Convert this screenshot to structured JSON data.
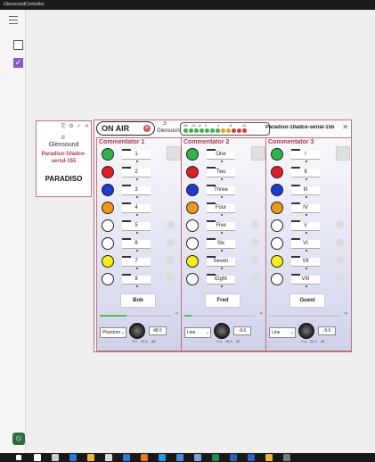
{
  "window": {
    "title": "GlensoundController"
  },
  "device_card": {
    "tools": [
      "⎘",
      "⚙",
      "✓",
      "✕"
    ],
    "brand": "Glensound",
    "device_name": "Paradiso-10adce-serial-155",
    "product": "PARADISO"
  },
  "main": {
    "on_air": "ON AIR",
    "brand": "Glensound",
    "serial": "Paradiso-10adce-serial-155",
    "meter_ticks": [
      "28",
      "-12",
      "-6",
      "0",
      "4",
      "8",
      "12"
    ],
    "meter_colors": [
      "#3cb043",
      "#3cb043",
      "#3cb043",
      "#3cb043",
      "#3cb043",
      "#3cb043",
      "#3cb043",
      "#e0a020",
      "#e0a020",
      "#d33",
      "#d33",
      "#d33"
    ]
  },
  "columns": [
    {
      "title": "Commentator 1",
      "rows": [
        {
          "label": "1",
          "color": "#2fb64a",
          "right": "square"
        },
        {
          "label": "2",
          "color": "#e01d24",
          "right": ""
        },
        {
          "label": "3",
          "color": "#1d3ad1",
          "right": ""
        },
        {
          "label": "4",
          "color": "#f29a18",
          "right": ""
        },
        {
          "label": "5",
          "color": "#ffffff",
          "right": "circle"
        },
        {
          "label": "6",
          "color": "#ffffff",
          "right": "circle"
        },
        {
          "label": "7",
          "color": "#f6f014",
          "right": "circle"
        },
        {
          "label": "8",
          "color": "#ffffff",
          "right": "circle"
        }
      ],
      "name": "Bob",
      "source": "Phantom",
      "gain": "48.5",
      "slider_level": 0.38,
      "scale": [
        "-9.0",
        "28.5",
        "dB"
      ]
    },
    {
      "title": "Commentator 2",
      "rows": [
        {
          "label": "One",
          "color": "#2fb64a",
          "right": "square"
        },
        {
          "label": "Two",
          "color": "#e01d24",
          "right": ""
        },
        {
          "label": "Three",
          "color": "#1d3ad1",
          "right": ""
        },
        {
          "label": "Four",
          "color": "#f29a18",
          "right": ""
        },
        {
          "label": "Five",
          "color": "#ffffff",
          "right": "circle"
        },
        {
          "label": "Six",
          "color": "#ffffff",
          "right": "circle"
        },
        {
          "label": "Seven",
          "color": "#f6f014",
          "right": "circle"
        },
        {
          "label": "Eight",
          "color": "#ffffff",
          "right": "circle"
        }
      ],
      "name": "Fred",
      "source": "Line",
      "gain": "-9.0",
      "slider_level": 0.1,
      "scale": [
        "-9.0",
        "28.5",
        "dB"
      ]
    },
    {
      "title": "Commentator 3",
      "rows": [
        {
          "label": "I",
          "color": "#2fb64a",
          "right": "square"
        },
        {
          "label": "II",
          "color": "#e01d24",
          "right": ""
        },
        {
          "label": "III",
          "color": "#1d3ad1",
          "right": ""
        },
        {
          "label": "IV",
          "color": "#f29a18",
          "right": ""
        },
        {
          "label": "V",
          "color": "#ffffff",
          "right": "circle"
        },
        {
          "label": "VI",
          "color": "#ffffff",
          "right": "circle"
        },
        {
          "label": "VII",
          "color": "#f6f014",
          "right": "circle"
        },
        {
          "label": "VIII",
          "color": "#ffffff",
          "right": "circle"
        }
      ],
      "name": "Guest",
      "source": "Line",
      "gain": "-9.0",
      "slider_level": 0,
      "scale": [
        "-9.0",
        "28.5",
        "dB"
      ]
    }
  ],
  "taskbar": {
    "items": [
      "windows-icon",
      "search-icon",
      "task-view-icon",
      "edge-icon",
      "file-explorer-icon",
      "store-icon",
      "photos-icon",
      "firefox-icon",
      "ie-icon",
      "app-icon",
      "mail-icon",
      "excel-icon",
      "word-icon",
      "outlook-icon",
      "explorer-icon",
      "app-icon-2"
    ],
    "colors": [
      "#ffffff",
      "#ffffff",
      "#cccccc",
      "#2d7bd6",
      "#e8b43a",
      "#d9d9d9",
      "#2e7bd6",
      "#e87722",
      "#1b9be0",
      "#3c8dd8",
      "#7aa2d6",
      "#1f8a4c",
      "#2b5eb6",
      "#2866c2",
      "#e8b43a",
      "#7a7a7a"
    ]
  }
}
